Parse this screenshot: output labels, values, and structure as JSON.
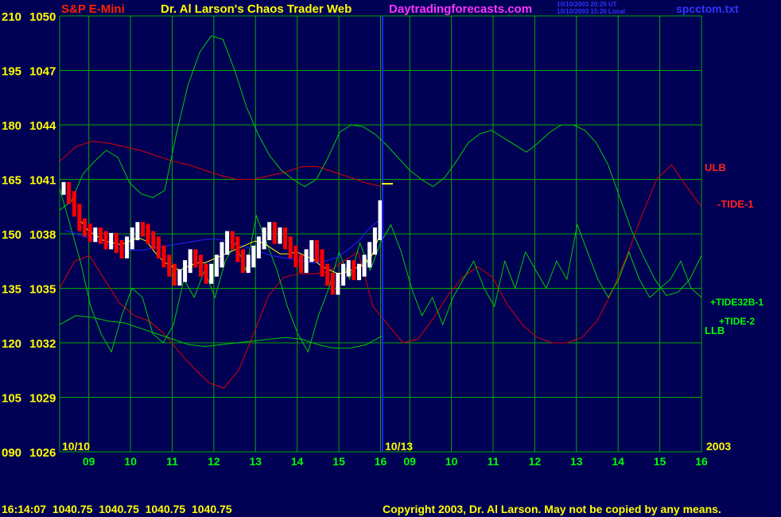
{
  "header": {
    "symbol": "S&P E-Mini",
    "title": "Dr. Al Larson's Chaos Trader Web",
    "site": "Daytradingforecasts.com",
    "stamp_ut": "10/10/2003 20:20 UT",
    "stamp_local": "10/10/2003 15:20 Local",
    "file": "spcctom.txt"
  },
  "footer": {
    "quote": "16:14:07  1040.75  1040.75  1040.75  1040.75",
    "copyright": "Copyright 2003, Dr. Al Larson. May not be copied by any means."
  },
  "colors": {
    "background": "#000055",
    "grid": "#00AA00",
    "tide_green": "#00CC00",
    "tide_red": "#DD0000",
    "up_bar": "#FFFFFF",
    "down_bar": "#FF0000",
    "blue_avg": "#2222FF",
    "yellow": "#FFFF00"
  },
  "chart_data": {
    "type": "line",
    "title": "S&P E-Mini",
    "y_left_labels": [
      "210",
      "195",
      "180",
      "165",
      "150",
      "135",
      "120",
      "105",
      "090"
    ],
    "y_right_labels": [
      "1050",
      "1047",
      "1044",
      "1041",
      "1038",
      "1035",
      "1032",
      "1029",
      "1026"
    ],
    "ylim": [
      1026,
      1050
    ],
    "y_osc_lim": [
      90,
      210
    ],
    "x_tick_labels": [
      "09",
      "10",
      "11",
      "12",
      "13",
      "14",
      "15",
      "16",
      "09",
      "10",
      "11",
      "12",
      "13",
      "14",
      "15",
      "16"
    ],
    "day_labels": [
      "10/10",
      "10/13"
    ],
    "year_label": "2003",
    "series_labels": [
      "ULB",
      "-TIDE-1",
      "+TIDE32B-1",
      "+TIDE-2",
      "LLB"
    ],
    "price_bars": {
      "day": "10/10",
      "start_time": "08:30",
      "interval_min": 5,
      "close": [
        1040.5,
        1040.0,
        1039.3,
        1038.5,
        1038.2,
        1037.9,
        1038.0,
        1037.8,
        1037.5,
        1037.7,
        1037.3,
        1037.0,
        1037.5,
        1038.0,
        1038.3,
        1038.2,
        1037.8,
        1037.5,
        1037.0,
        1036.5,
        1036.0,
        1035.5,
        1035.7,
        1036.2,
        1036.8,
        1036.5,
        1036.0,
        1035.6,
        1036.0,
        1036.5,
        1037.2,
        1037.8,
        1037.5,
        1036.8,
        1036.2,
        1036.5,
        1037.0,
        1037.5,
        1038.0,
        1038.3,
        1037.8,
        1038.0,
        1037.5,
        1037.0,
        1036.5,
        1036.2,
        1036.8,
        1037.3,
        1036.8,
        1036.0,
        1035.5,
        1035.0,
        1035.5,
        1036.0,
        1036.2,
        1035.8,
        1036.0,
        1036.5,
        1037.2,
        1038.0,
        1039.5
      ]
    },
    "price_overlays": {
      "yellow_ma": [
        1038.8,
        1038.2,
        1037.9,
        1037.6,
        1037.5,
        1037.4,
        1037.6,
        1037.8,
        1037.6,
        1037.0,
        1036.5,
        1036.2,
        1036.0,
        1036.2,
        1036.4,
        1036.4,
        1036.6,
        1036.8,
        1037.0,
        1037.2,
        1037.4,
        1037.6,
        1037.5,
        1037.2,
        1036.9,
        1036.9,
        1037.0,
        1036.8,
        1036.6,
        1036.2,
        1036.0,
        1035.8,
        1035.9,
        1036.1,
        1036.3,
        1036.8,
        1038.0
      ],
      "blue_ma": [
        1038.2,
        1038.0,
        1037.8,
        1037.6,
        1037.4,
        1037.2,
        1037.1,
        1037.1,
        1037.2,
        1037.3,
        1037.4,
        1037.5,
        1037.6,
        1037.7,
        1037.7,
        1037.6,
        1037.4,
        1037.2,
        1037.0,
        1036.8,
        1036.7,
        1036.6,
        1036.5,
        1036.4,
        1036.5,
        1036.7,
        1037.1,
        1037.6,
        1038.3,
        1038.8
      ]
    },
    "tides": [
      {
        "name": "ULB",
        "color": "#DD0000",
        "values": [
          1042.0,
          1042.8,
          1043.1,
          1043.0,
          1042.8,
          1042.6,
          1042.3,
          1042.0,
          1041.8,
          1041.5,
          1041.2,
          1041.0,
          1041.0,
          1041.2,
          1041.4,
          1041.7,
          1041.7,
          1041.4,
          1041.1,
          1040.8,
          1040.6
        ]
      },
      {
        "name": "-TIDE-1",
        "color": "#DD0000",
        "values": [
          1035.0,
          1036.5,
          1036.8,
          1035.5,
          1034.2,
          1033.5,
          1033.2,
          1032.5,
          1031.5,
          1030.6,
          1029.8,
          1029.5,
          1030.5,
          1032.5,
          1034.6,
          1035.6,
          1035.8,
          1035.8,
          1035.9,
          1036.5,
          1037.0,
          1034.0,
          1033.0,
          1032.0,
          1032.2,
          1033.3,
          1034.6,
          1035.6,
          1036.2,
          1035.6,
          1034.1,
          1033.0,
          1032.3,
          1032.0,
          1032.0,
          1032.3,
          1033.2,
          1034.8,
          1036.8,
          1039.0,
          1041.0,
          1041.8,
          1040.6,
          1039.5
        ]
      },
      {
        "name": "+TIDE32B-1",
        "color": "#00CC00",
        "values": [
          1040.5,
          1038.5,
          1036.5,
          1034.0,
          1032.5,
          1031.5,
          1033.5,
          1035.0,
          1034.5,
          1032.5,
          1032.0,
          1033.0,
          1035.5,
          1034.5,
          1036.0,
          1034.5,
          1036.5,
          1037.5,
          1036.0,
          1039.0,
          1037.5,
          1036.0,
          1034.0,
          1032.5,
          1031.5,
          1033.5,
          1035.0,
          1037.0,
          1035.5,
          1037.5,
          1036.0,
          1037.5,
          1038.5,
          1037.0,
          1035.0,
          1033.5,
          1034.5,
          1033.0,
          1034.5,
          1035.5,
          1036.5,
          1035.0,
          1034.0,
          1036.5,
          1035.0,
          1037.0,
          1036.0,
          1035.0,
          1036.5,
          1035.5,
          1038.5,
          1037.0,
          1035.5,
          1034.5,
          1035.5,
          1037.0,
          1035.5,
          1034.5,
          1035.0,
          1035.5,
          1036.5,
          1035.0,
          1034.5
        ]
      },
      {
        "name": "+TIDE-2",
        "color": "#00CC00",
        "values": [
          1039.3,
          1039.8,
          1041.3,
          1042.0,
          1042.6,
          1042.2,
          1040.8,
          1040.2,
          1040.0,
          1040.4,
          1043.5,
          1046.2,
          1048.0,
          1048.9,
          1048.7,
          1047.0,
          1045.0,
          1043.5,
          1042.3,
          1041.5,
          1041.0,
          1040.6,
          1041.0,
          1042.2,
          1043.6,
          1044.0,
          1043.9,
          1043.5,
          1042.9,
          1042.2,
          1041.5,
          1041.0,
          1040.6,
          1041.1,
          1042.0,
          1043.0,
          1043.5,
          1043.7,
          1043.3,
          1042.9,
          1042.5,
          1043.0,
          1043.6,
          1044.0,
          1044.0,
          1043.7,
          1043.0,
          1041.8,
          1040.0,
          1038.2,
          1036.8,
          1035.5,
          1034.6,
          1034.8,
          1035.5,
          1036.8
        ]
      },
      {
        "name": "LLB",
        "color": "#00CC00",
        "values": [
          1033.0,
          1033.5,
          1033.4,
          1033.2,
          1033.1,
          1032.8,
          1032.5,
          1032.2,
          1031.9,
          1031.8,
          1031.9,
          1032.0,
          1032.1,
          1032.2,
          1032.3,
          1032.2,
          1031.9,
          1031.7,
          1031.7,
          1031.9,
          1032.4
        ]
      }
    ]
  }
}
